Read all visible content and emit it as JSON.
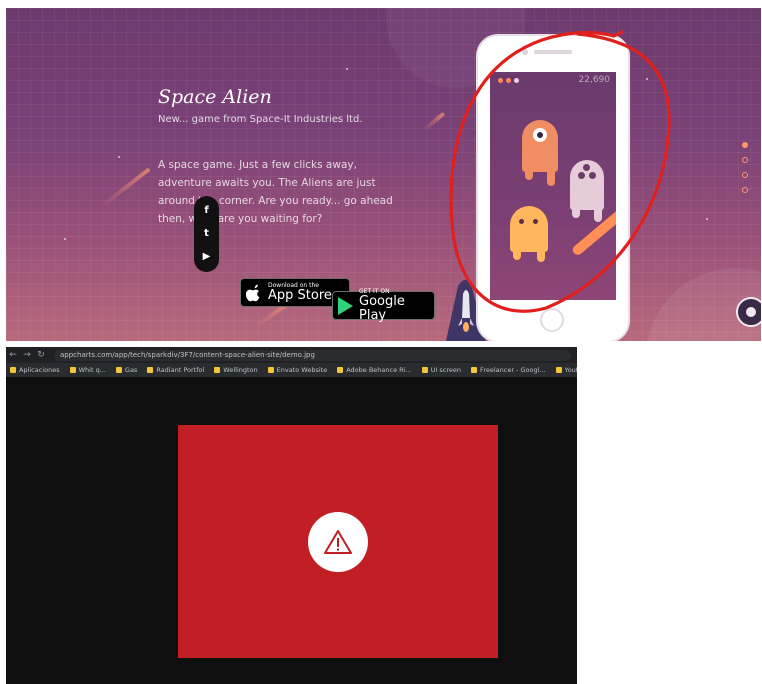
{
  "landing": {
    "app_name": "Space Alien",
    "subtitle": "New... game from Space-It Industries ltd.",
    "description": "A space game. Just a few clicks away, adventure awaits you. The Aliens are just around the corner. Are you ready... go ahead then, what are you waiting for?",
    "social": {
      "facebook": "f",
      "twitter": "t",
      "youtube": "▶"
    },
    "app_store": {
      "small": "Download on the",
      "big": "App Store"
    },
    "google_play": {
      "small": "GET IT ON",
      "big": "Google Play"
    },
    "game_score": "22,690",
    "lives_remaining": 2,
    "lives_total": 3,
    "pager_pages": 4,
    "pager_active": 1,
    "annotation_color": "#e0201c",
    "icons": [
      "facebook-icon",
      "twitter-icon",
      "youtube-icon",
      "apple-icon",
      "google-play-icon",
      "rocket-icon",
      "chat-icon"
    ]
  },
  "browser": {
    "nav": {
      "back": "←",
      "forward": "→",
      "reload": "↻"
    },
    "url": "appcharts.com/app/tech/sparkdiv/3F7/content-space-alien-site/demo.jpg",
    "bookmarks": [
      "Aplicaciones",
      "Whit q...",
      "Gas",
      "Radiant Portfol",
      "Wellington",
      "Envato Website",
      "Adobe Behance Ri...",
      "UI screen",
      "Freelancer - Googl...",
      "Youtube Search Engi..."
    ],
    "error_color": "#c11f24",
    "error_icon": "warning-triangle-icon"
  }
}
